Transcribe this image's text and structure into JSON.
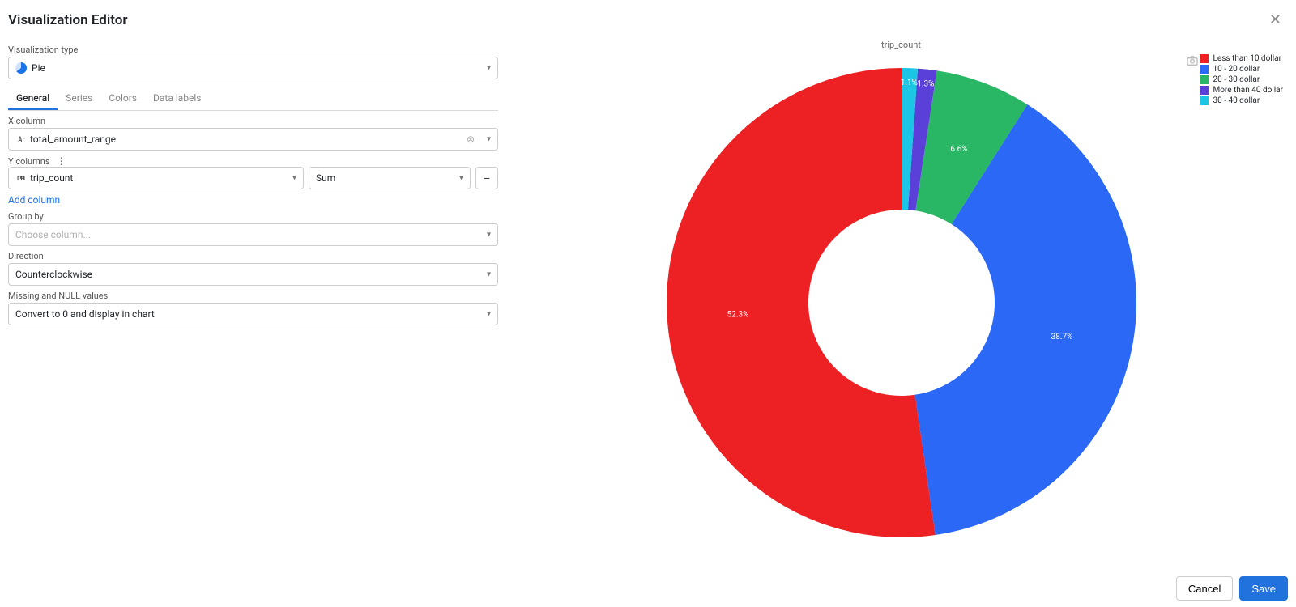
{
  "header": {
    "title": "Visualization Editor"
  },
  "left": {
    "vis_type_label": "Visualization type",
    "vis_type_value": "Pie",
    "tabs": {
      "general": "General",
      "series": "Series",
      "colors": "Colors",
      "data_labels": "Data labels"
    },
    "x_label": "X column",
    "x_value": "total_amount_range",
    "y_label": "Y columns",
    "y_value": "trip_count",
    "y_agg": "Sum",
    "add_column": "Add column",
    "group_by_label": "Group by",
    "group_by_placeholder": "Choose column...",
    "direction_label": "Direction",
    "direction_value": "Counterclockwise",
    "null_label": "Missing and NULL values",
    "null_value": "Convert to 0 and display in chart"
  },
  "footer": {
    "cancel": "Cancel",
    "save": "Save"
  },
  "chart_data": {
    "type": "pie",
    "title": "trip_count",
    "direction": "counterclockwise",
    "donut": true,
    "series": [
      {
        "name": "Less than 10 dollar",
        "value": 52.3,
        "label": "52.3%",
        "color": "#ed2024"
      },
      {
        "name": "10 - 20 dollar",
        "value": 38.7,
        "label": "38.7%",
        "color": "#2b68f6"
      },
      {
        "name": "20 - 30 dollar",
        "value": 6.6,
        "label": "6.6%",
        "color": "#29b765"
      },
      {
        "name": "More than 40 dollar",
        "value": 1.3,
        "label": "1.3%",
        "color": "#5a3fd8"
      },
      {
        "name": "30 - 40 dollar",
        "value": 1.1,
        "label": "1.1%",
        "color": "#1bc6e4"
      }
    ]
  }
}
